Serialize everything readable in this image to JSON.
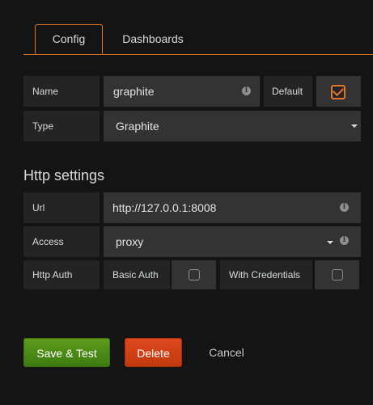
{
  "tabs": [
    {
      "label": "Config",
      "active": true
    },
    {
      "label": "Dashboards",
      "active": false
    }
  ],
  "basic": {
    "name_label": "Name",
    "name_value": "graphite",
    "default_label": "Default",
    "default_checked": true,
    "type_label": "Type",
    "type_value": "Graphite"
  },
  "http": {
    "heading": "Http settings",
    "url_label": "Url",
    "url_value": "http://127.0.0.1:8008",
    "access_label": "Access",
    "access_value": "proxy",
    "auth_label": "Http Auth",
    "basic_auth_label": "Basic Auth",
    "basic_auth_checked": false,
    "with_credentials_label": "With Credentials",
    "with_credentials_checked": false
  },
  "actions": {
    "save_label": "Save & Test",
    "delete_label": "Delete",
    "cancel_label": "Cancel"
  },
  "colors": {
    "accent": "#e0752d",
    "save": "#4e8c1a",
    "delete": "#d44013",
    "background": "#141414"
  },
  "icons": {
    "info": "i",
    "caret": "caret-down"
  }
}
